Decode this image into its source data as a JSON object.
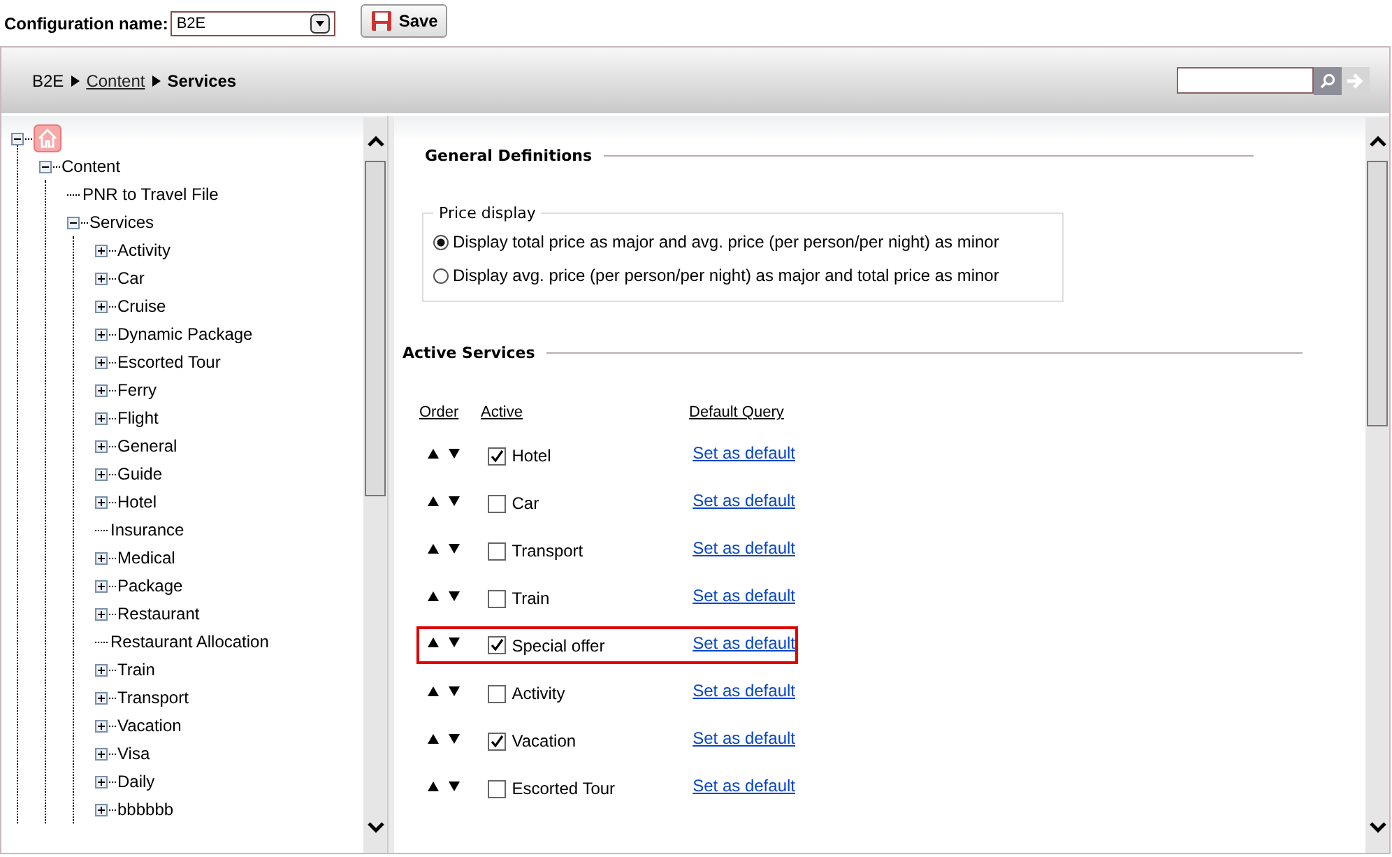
{
  "toolbar": {
    "config_label": "Configuration name:",
    "config_value": "B2E",
    "save_label": "Save"
  },
  "breadcrumb": [
    {
      "label": "B2E",
      "kind": "text"
    },
    {
      "label": "Content",
      "kind": "link"
    },
    {
      "label": "Services",
      "kind": "current"
    }
  ],
  "tree": {
    "expanded": true,
    "children": [
      {
        "label": "Content",
        "expanded": true,
        "children": [
          {
            "label": "PNR to Travel File"
          },
          {
            "label": "Services",
            "expanded": true,
            "children": [
              {
                "label": "Activity",
                "expanded": false
              },
              {
                "label": "Car",
                "expanded": false
              },
              {
                "label": "Cruise",
                "expanded": false
              },
              {
                "label": "Dynamic Package",
                "expanded": false
              },
              {
                "label": "Escorted Tour",
                "expanded": false
              },
              {
                "label": "Ferry",
                "expanded": false
              },
              {
                "label": "Flight",
                "expanded": false
              },
              {
                "label": "General",
                "expanded": false
              },
              {
                "label": "Guide",
                "expanded": false
              },
              {
                "label": "Hotel",
                "expanded": false
              },
              {
                "label": "Insurance"
              },
              {
                "label": "Medical",
                "expanded": false
              },
              {
                "label": "Package",
                "expanded": false
              },
              {
                "label": "Restaurant",
                "expanded": false
              },
              {
                "label": "Restaurant Allocation"
              },
              {
                "label": "Train",
                "expanded": false
              },
              {
                "label": "Transport",
                "expanded": false
              },
              {
                "label": "Vacation",
                "expanded": false
              },
              {
                "label": "Visa",
                "expanded": false
              },
              {
                "label": "Daily",
                "expanded": false
              },
              {
                "label": "bbbbbb",
                "expanded": false
              }
            ]
          }
        ]
      }
    ]
  },
  "general": {
    "title": "General Definitions",
    "price_display": {
      "legend": "Price display",
      "options": [
        {
          "label": "Display total price as major and avg. price (per person/per night) as minor",
          "selected": true
        },
        {
          "label": "Display avg. price (per person/per night) as major and total price as minor",
          "selected": false
        }
      ]
    }
  },
  "services": {
    "title": "Active Services",
    "columns": [
      "Order",
      "Active",
      "Default Query"
    ],
    "rows": [
      {
        "name": "Hotel",
        "checked": true,
        "link": "Set as default",
        "highlighted": false
      },
      {
        "name": "Car",
        "checked": false,
        "link": "Set as default",
        "highlighted": false
      },
      {
        "name": "Transport",
        "checked": false,
        "link": "Set as default",
        "highlighted": false
      },
      {
        "name": "Train",
        "checked": false,
        "link": "Set as default",
        "highlighted": false
      },
      {
        "name": "Special offer",
        "checked": true,
        "link": "Set as default",
        "highlighted": true
      },
      {
        "name": "Activity",
        "checked": false,
        "link": "Set as default",
        "highlighted": false
      },
      {
        "name": "Vacation",
        "checked": true,
        "link": "Set as default",
        "highlighted": false
      },
      {
        "name": "Escorted Tour",
        "checked": false,
        "link": "Set as default",
        "highlighted": false
      }
    ]
  }
}
